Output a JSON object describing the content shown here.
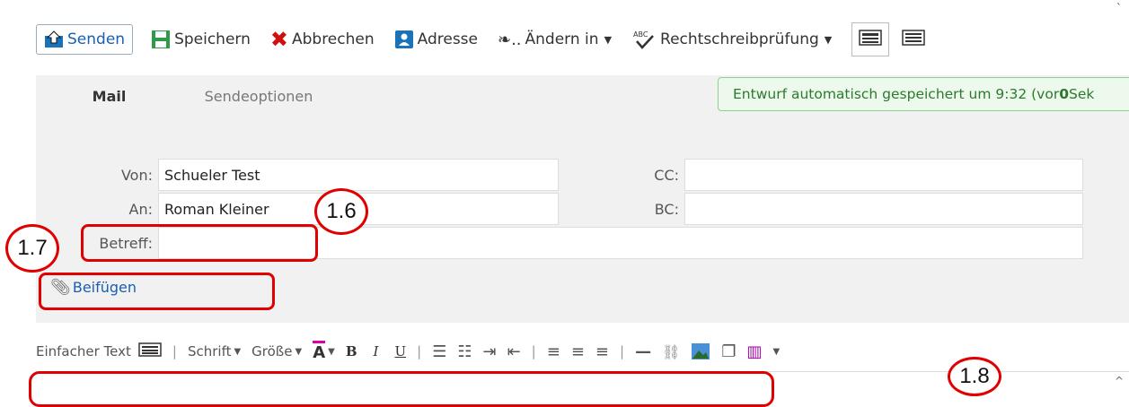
{
  "toolbar": {
    "send_label": "Senden",
    "save_label": "Speichern",
    "cancel_label": "Abbrechen",
    "address_label": "Adresse",
    "change_label": "Ändern in",
    "spell_label": "Rechtschreibprüfung"
  },
  "tabs": {
    "mail": "Mail",
    "send_options": "Sendeoptionen"
  },
  "status": {
    "prefix": "Entwurf automatisch gespeichert um 9:32 (vor ",
    "count": "0",
    "suffix": " Sek"
  },
  "fields": {
    "from_label": "Von:",
    "from_value": "Schueler Test",
    "to_label": "An:",
    "to_value": "Roman Kleiner",
    "subject_label": "Betreff:",
    "subject_value": "",
    "cc_label": "CC:",
    "cc_value": "",
    "bc_label": "BC:",
    "bc_value": ""
  },
  "attach_label": "Beifügen",
  "format": {
    "plain_text": "Einfacher Text",
    "font": "Schrift",
    "size": "Größe",
    "bold": "B",
    "italic": "I",
    "underline": "U"
  },
  "annotations": {
    "a16": "1.6",
    "a17": "1.7",
    "a18": "1.8"
  },
  "colors": {
    "accent": "#1a5fb4",
    "annotation_red": "#e00000",
    "status_green": "#2b7a2b"
  }
}
